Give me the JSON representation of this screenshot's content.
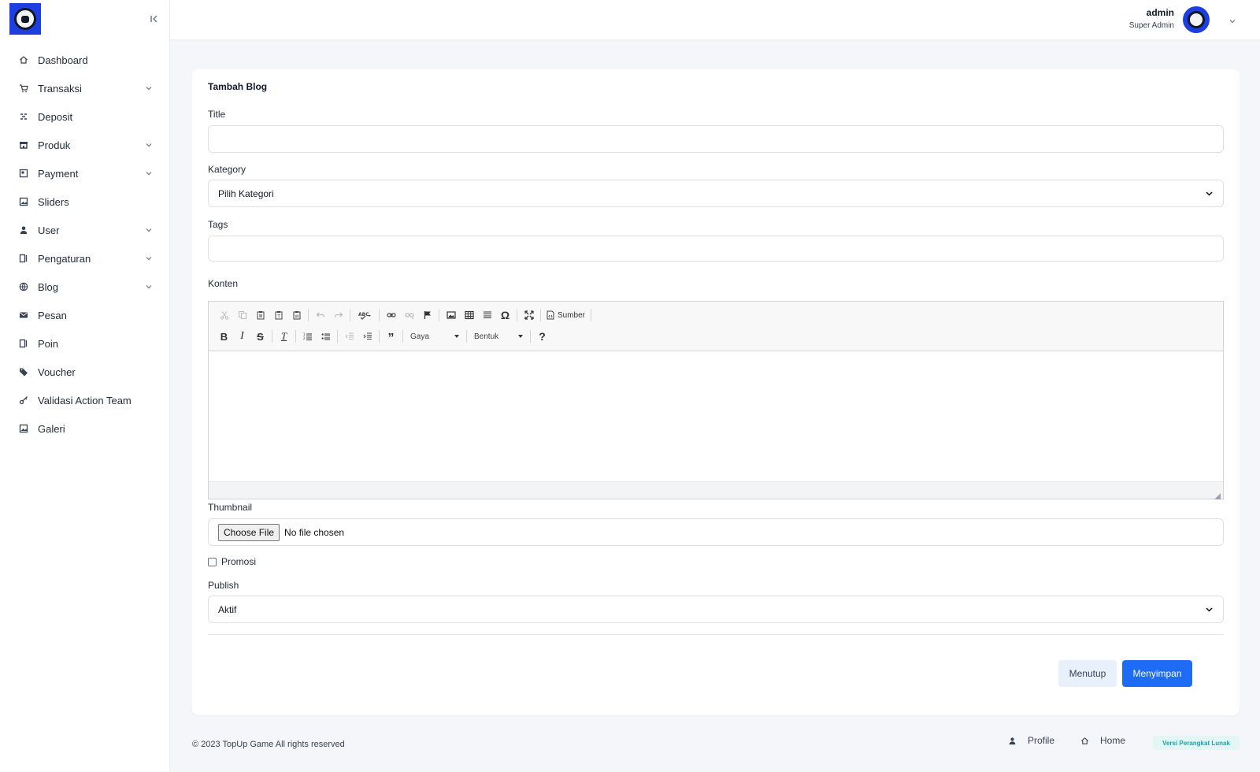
{
  "sidebar": {
    "items": [
      {
        "label": "Dashboard",
        "icon": "home-icon",
        "has_submenu": false
      },
      {
        "label": "Transaksi",
        "icon": "cart-icon",
        "has_submenu": true
      },
      {
        "label": "Deposit",
        "icon": "deposit-icon",
        "has_submenu": false
      },
      {
        "label": "Produk",
        "icon": "store-icon",
        "has_submenu": true
      },
      {
        "label": "Payment",
        "icon": "wallet-icon",
        "has_submenu": true
      },
      {
        "label": "Sliders",
        "icon": "image-icon",
        "has_submenu": false
      },
      {
        "label": "User",
        "icon": "user-icon",
        "has_submenu": true
      },
      {
        "label": "Pengaturan",
        "icon": "settings-panel-icon",
        "has_submenu": true
      },
      {
        "label": "Blog",
        "icon": "globe-icon",
        "has_submenu": true
      },
      {
        "label": "Pesan",
        "icon": "mail-icon",
        "has_submenu": false
      },
      {
        "label": "Poin",
        "icon": "panel-icon",
        "has_submenu": false
      },
      {
        "label": "Voucher",
        "icon": "tag-icon",
        "has_submenu": false
      },
      {
        "label": "Validasi Action Team",
        "icon": "key-icon",
        "has_submenu": false
      },
      {
        "label": "Galeri",
        "icon": "gallery-icon",
        "has_submenu": false
      }
    ]
  },
  "header": {
    "user_name": "admin",
    "user_role": "Super Admin"
  },
  "form": {
    "title": "Tambah Blog",
    "title_label": "Title",
    "title_value": "",
    "category_label": "Kategory",
    "category_value": "Pilih Kategori",
    "tags_label": "Tags",
    "tags_value": "",
    "content_label": "Konten",
    "editor": {
      "source_label": "Sumber",
      "style_combo": "Gaya",
      "format_combo": "Bentuk"
    },
    "thumbnail_label": "Thumbnail",
    "file_button": "Choose File",
    "file_status": "No file chosen",
    "promo_label": "Promosi",
    "promo_checked": false,
    "publish_label": "Publish",
    "publish_value": "Aktif",
    "close_button": "Menutup",
    "save_button": "Menyimpan"
  },
  "footer": {
    "copyright": "© 2023 TopUp Game All rights reserved",
    "profile_link": "Profile",
    "home_link": "Home",
    "version_badge": "Versi Perangkat Lunak"
  },
  "colors": {
    "primary": "#1e6cf6",
    "logo_bg": "#1d3fe0",
    "page_bg": "#f5f6fa",
    "badge_text": "#1aa3a3"
  }
}
